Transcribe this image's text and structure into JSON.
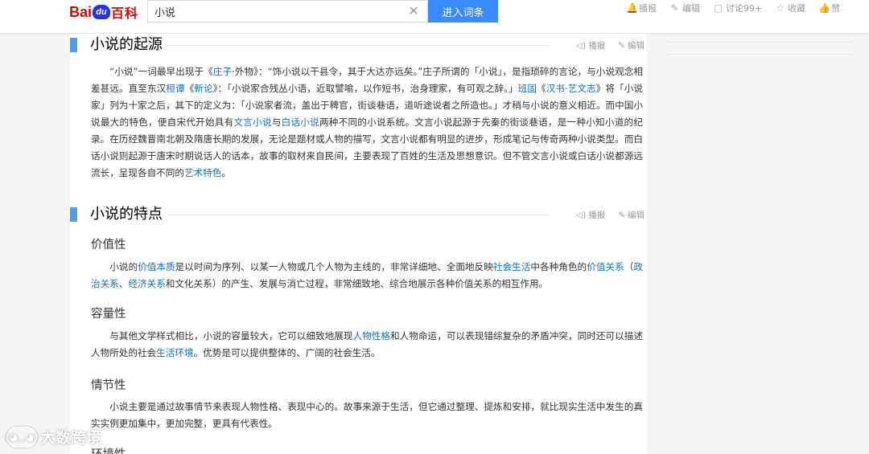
{
  "header": {
    "logo": {
      "part1": "Bai",
      "paw": "du",
      "part2": "百科"
    },
    "search": {
      "value": "小说",
      "button": "进入词条"
    },
    "tools": [
      {
        "icon": "bell-icon",
        "glyph": "🔔",
        "label": "播报"
      },
      {
        "icon": "pencil-icon",
        "glyph": "✎",
        "label": "编辑"
      },
      {
        "icon": "chat-icon",
        "glyph": "▢",
        "label": "讨论99+"
      },
      {
        "icon": "star-icon",
        "glyph": "☆",
        "label": "收藏"
      },
      {
        "icon": "thumb-up-icon",
        "glyph": "👍",
        "label": "赞"
      }
    ]
  },
  "section_actions": {
    "broadcast": "播报",
    "edit": "编辑"
  },
  "sections": [
    {
      "title": "小说的起源",
      "paragraph": {
        "t1": "“小说”一词最早出现于《",
        "l1": "庄子",
        "t2": "·外物》：“饰小说以干县令，其于大达亦远矣。”庄子所谓的「小说」，是指琐碎的言论，与小说观念相差甚远。直至东汉",
        "l2": "桓谭",
        "t3": "《",
        "l3": "新论",
        "t4": "》：「小说家合残丛小语，近取譬喻，以作短书，治身理家，有可观之辞。」",
        "l4": "班固",
        "t5": "《",
        "l5": "汉书·艺文志",
        "t6": "》将「小说家」列为十家之后，其下的定义为：「小说家者流，盖出于稗官，街谈巷语，道听途说者之所造也。」才稍与小说的意义相近。而中国小说最大的特色，便自宋代开始具有",
        "l6": "文言小说",
        "t7": "与",
        "l7": "白话小说",
        "t8": "两种不同的小说系统。文言小说起源于先秦的街谈巷语，是一种小知小道的纪录。在历经魏晋南北朝及隋唐长期的发展，无论是题材或人物的描写，文言小说都有明显的进步，形成笔记与传奇两种小说类型。而白话小说则起源于唐宋时期说话人的话本，故事的取材来自民间，主要表现了百姓的生活及思想意识。但不管文言小说或白话小说都源远流长，呈现各自不同的",
        "l8": "艺术特色",
        "t9": "。"
      }
    },
    {
      "title": "小说的特点",
      "subsections": [
        {
          "title": "价值性",
          "paragraph": {
            "t1": "小说的",
            "l1": "价值本质",
            "t2": "是以时间为序列、以某一人物或几个人物为主线的，非常详细地、全面地反映",
            "l2": "社会生活",
            "t3": "中各种角色的",
            "l3": "价值关系",
            "t4": "（",
            "l4": "政治关系",
            "t5": "、",
            "l5": "经济关系",
            "t6": "和文化关系）的产生、发展与消亡过程，非常细致地、综合地展示各种价值关系的相互作用。"
          }
        },
        {
          "title": "容量性",
          "paragraph": {
            "t1": "与其他文学样式相比，小说的容量较大，它可以细致地展现",
            "l1": "人物性格",
            "t2": "和人物命运，可以表现错综复杂的矛盾冲突，同时还可以描述人物所处的社会",
            "l2": "生活环境",
            "t3": "。优势是可以提供整体的、广阔的社会生活。"
          }
        },
        {
          "title": "情节性",
          "paragraph": {
            "t1": "小说主要是通过故事情节来表现人物性格、表现中心的。故事来源于生活，但它通过整理、提炼和安排，就比现实生活中发生的真实实例更加集中，更加完整，更具有代表性。"
          }
        },
        {
          "title": "环境性"
        }
      ]
    }
  ],
  "watermark": {
    "logo_text": "(◕◡◕)",
    "text": "大数跨境"
  }
}
